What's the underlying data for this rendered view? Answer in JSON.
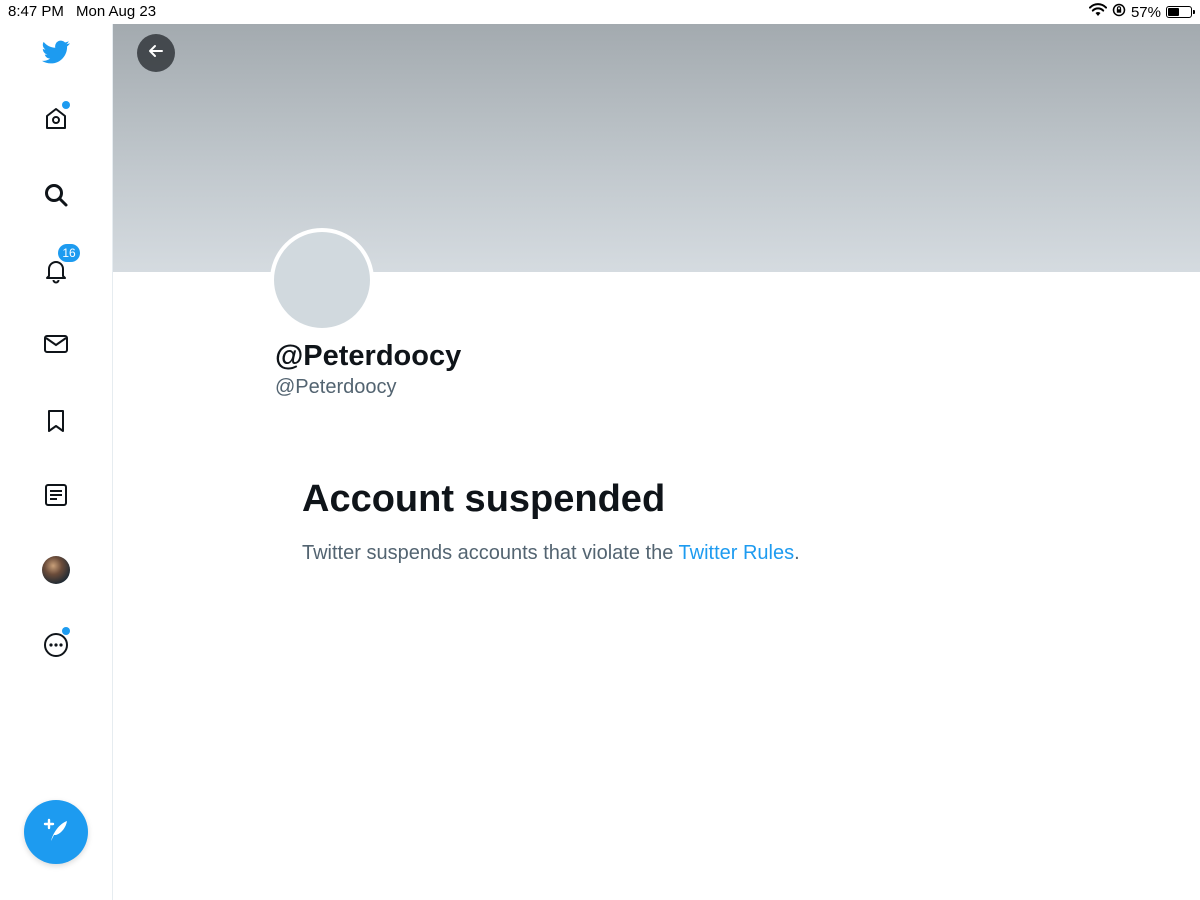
{
  "status_bar": {
    "time": "8:47 PM",
    "date": "Mon Aug 23",
    "battery_percent": "57%",
    "battery_level": 0.57,
    "icons": [
      "wifi-icon",
      "orientation-lock-icon",
      "battery-icon"
    ]
  },
  "sidebar": {
    "items": [
      {
        "name": "twitter-logo-icon"
      },
      {
        "name": "home-icon",
        "has_dot": true
      },
      {
        "name": "search-icon"
      },
      {
        "name": "notifications-icon",
        "badge": "16"
      },
      {
        "name": "messages-icon"
      },
      {
        "name": "bookmarks-icon"
      },
      {
        "name": "lists-icon"
      },
      {
        "name": "profile-avatar"
      },
      {
        "name": "more-icon",
        "has_dot": true
      }
    ],
    "compose_icon": "compose-tweet-icon"
  },
  "profile": {
    "display_name": "@Peterdoocy",
    "handle": "@Peterdoocy",
    "back_icon": "back-arrow-icon"
  },
  "suspension": {
    "title": "Account suspended",
    "text_before": "Twitter suspends accounts that violate the ",
    "link_text": "Twitter Rules",
    "text_after": "."
  },
  "colors": {
    "accent": "#1d9bf0",
    "text_primary": "#0f1419",
    "text_secondary": "#536471",
    "banner_top": "#a3aaaf",
    "banner_bottom": "#d5dbe0"
  }
}
